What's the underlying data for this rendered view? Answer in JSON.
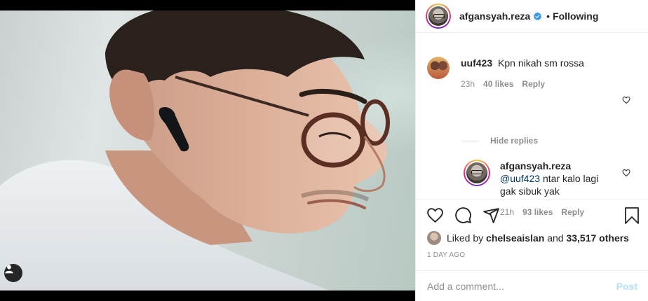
{
  "post": {
    "author": "afgansyah.reza",
    "follow_status": "Following",
    "dot": "•"
  },
  "comments": [
    {
      "user": "uuf423",
      "text": "Kpn nikah sm rossa",
      "time": "23h",
      "likes": "40 likes",
      "reply_label": "Reply"
    }
  ],
  "hide_replies_label": "Hide replies",
  "reply": {
    "user": "afgansyah.reza",
    "mention": "@uuf423",
    "text": "ntar kalo lagi gak sibuk yak",
    "time": "21h",
    "likes": "93 likes",
    "reply_label": "Reply"
  },
  "likes": {
    "prefix": "Liked by",
    "user": "chelseaislan",
    "middle": "and",
    "others": "33,517 others"
  },
  "timestamp": "1 DAY AGO",
  "add_comment": {
    "placeholder": "Add a comment...",
    "post_label": "Post"
  },
  "colors": {
    "verified": "#3897f0",
    "post_disabled": "#b2dffc",
    "mention": "#00376b"
  },
  "icons": [
    "user-tag-icon",
    "verified-icon",
    "heart-icon",
    "comment-icon",
    "share-icon",
    "bookmark-icon"
  ]
}
